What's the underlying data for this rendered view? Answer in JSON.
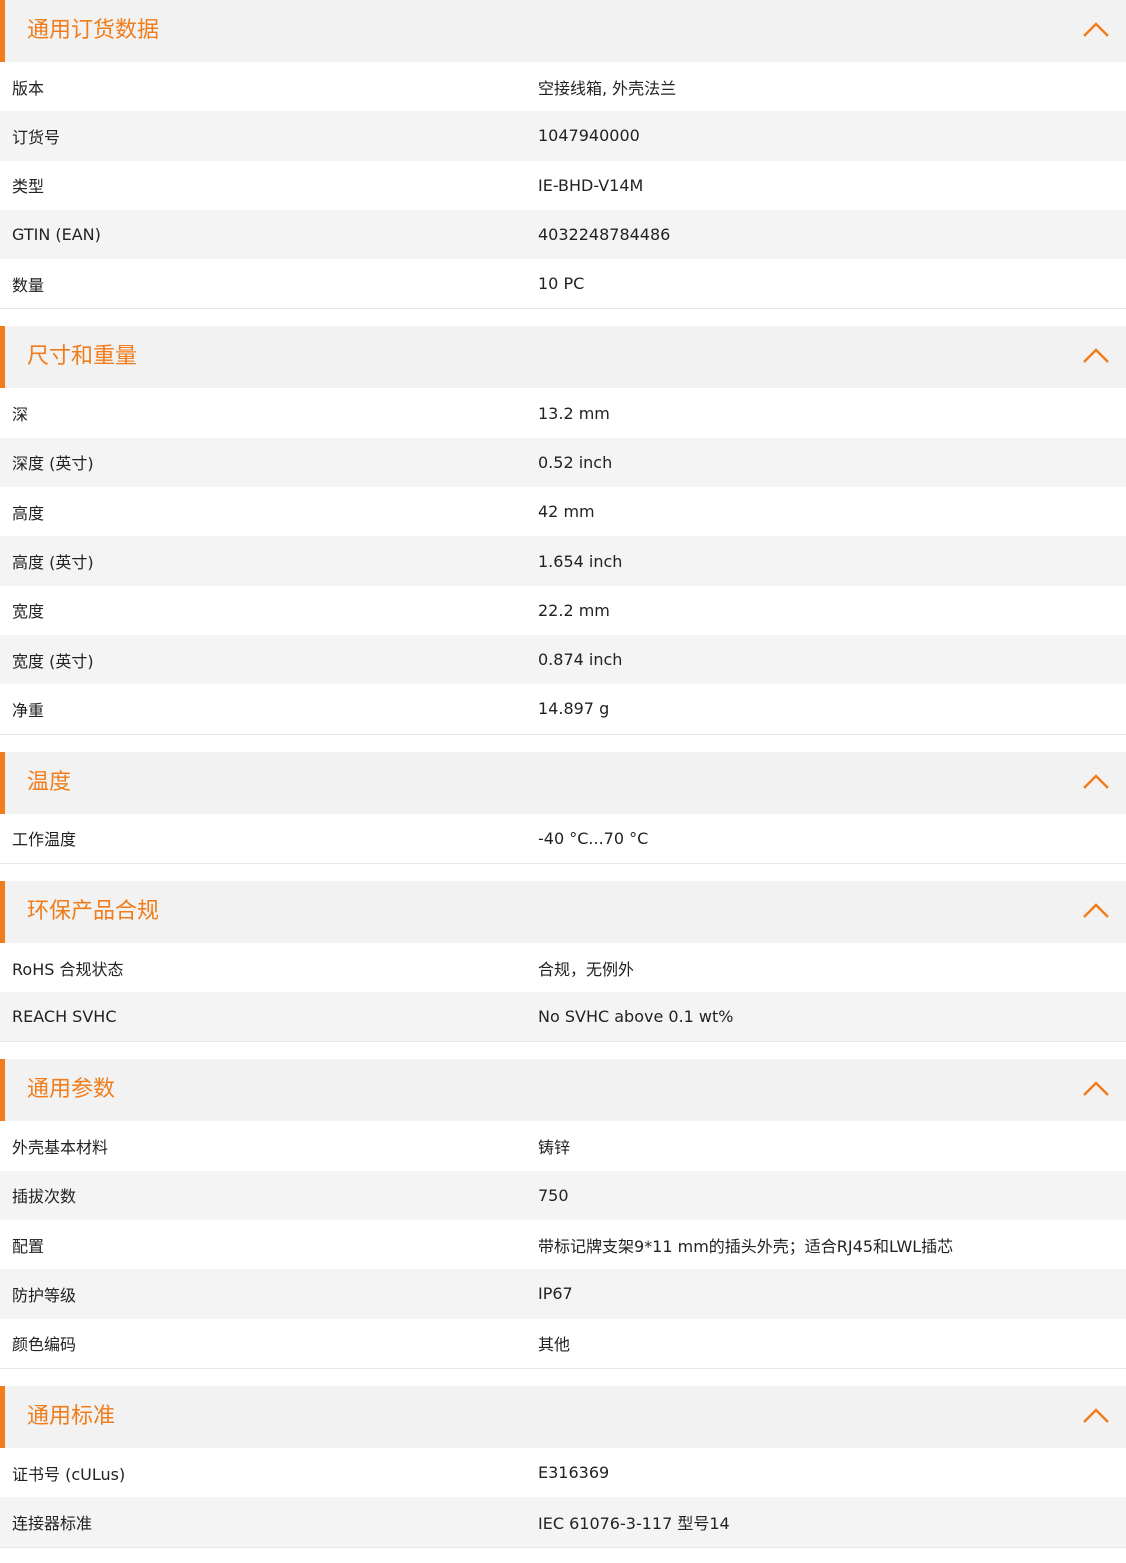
{
  "accent_color": "#f07c1b",
  "sections": [
    {
      "title": "通用订货数据",
      "toggle_icon": "chevron-up-icon",
      "rows": [
        {
          "label": "版本",
          "value": "空接线箱, 外壳法兰"
        },
        {
          "label": "订货号",
          "value": "1047940000"
        },
        {
          "label": "类型",
          "value": "IE-BHD-V14M"
        },
        {
          "label": "GTIN (EAN)",
          "value": "4032248784486"
        },
        {
          "label": "数量",
          "value": "10  PC"
        }
      ]
    },
    {
      "title": "尺寸和重量",
      "toggle_icon": "chevron-up-icon",
      "rows": [
        {
          "label": "深",
          "value": "13.2  mm"
        },
        {
          "label": "深度 (英寸)",
          "value": "0.52  inch"
        },
        {
          "label": "高度",
          "value": "42  mm"
        },
        {
          "label": "高度 (英寸)",
          "value": "1.654  inch"
        },
        {
          "label": "宽度",
          "value": "22.2  mm"
        },
        {
          "label": "宽度 (英寸)",
          "value": "0.874  inch"
        },
        {
          "label": "净重",
          "value": "14.897  g"
        }
      ]
    },
    {
      "title": "温度",
      "toggle_icon": "chevron-up-icon",
      "rows": [
        {
          "label": "工作温度",
          "value": "-40 °C...70 °C"
        }
      ]
    },
    {
      "title": "环保产品合规",
      "toggle_icon": "chevron-up-icon",
      "rows": [
        {
          "label": "RoHS 合规状态",
          "value": "合规，无例外"
        },
        {
          "label": "REACH SVHC",
          "value": "No SVHC above 0.1 wt%"
        }
      ]
    },
    {
      "title": "通用参数",
      "toggle_icon": "chevron-up-icon",
      "rows": [
        {
          "label": "外壳基本材料",
          "value": "铸锌"
        },
        {
          "label": "插拔次数",
          "value": "750"
        },
        {
          "label": "配置",
          "value": "带标记牌支架9*11 mm的插头外壳；适合RJ45和LWL插芯"
        },
        {
          "label": "防护等级",
          "value": "IP67"
        },
        {
          "label": "颜色编码",
          "value": "其他"
        }
      ]
    },
    {
      "title": "通用标准",
      "toggle_icon": "chevron-up-icon",
      "rows": [
        {
          "label": "证书号 (cULus)",
          "value": "E316369"
        },
        {
          "label": "连接器标准",
          "value": "IEC 61076-3-117 型号14"
        }
      ]
    }
  ]
}
